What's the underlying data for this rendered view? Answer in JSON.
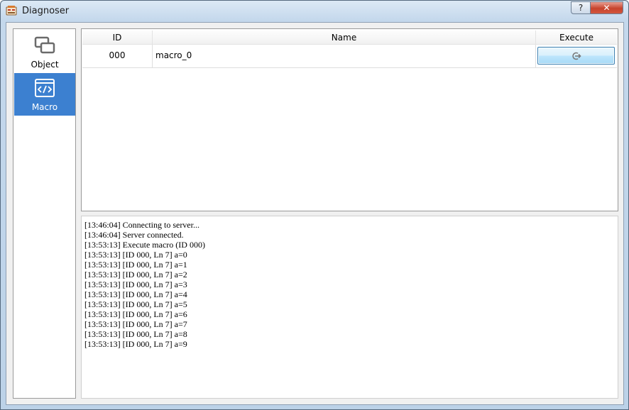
{
  "window": {
    "title": "Diagnoser",
    "help_label": "?",
    "close_label": "✕"
  },
  "sidebar": {
    "items": [
      {
        "label": "Object",
        "icon": "object-icon"
      },
      {
        "label": "Macro",
        "icon": "macro-code-icon"
      }
    ],
    "selected_color": "#3c80d0"
  },
  "grid": {
    "columns": [
      "ID",
      "Name",
      "Execute"
    ],
    "rows": [
      {
        "id": "000",
        "name": "macro_0",
        "execute_icon": "execute-icon"
      }
    ]
  },
  "log": {
    "lines": [
      "[13:46:04] Connecting to server...",
      "[13:46:04] Server connected.",
      "[13:53:13] Execute macro (ID 000)",
      "[13:53:13] [ID 000, Ln 7] a=0",
      "[13:53:13] [ID 000, Ln 7] a=1",
      "[13:53:13] [ID 000, Ln 7] a=2",
      "[13:53:13] [ID 000, Ln 7] a=3",
      "[13:53:13] [ID 000, Ln 7] a=4",
      "[13:53:13] [ID 000, Ln 7] a=5",
      "[13:53:13] [ID 000, Ln 7] a=6",
      "[13:53:13] [ID 000, Ln 7] a=7",
      "[13:53:13] [ID 000, Ln 7] a=8",
      "[13:53:13] [ID 000, Ln 7] a=9"
    ]
  }
}
